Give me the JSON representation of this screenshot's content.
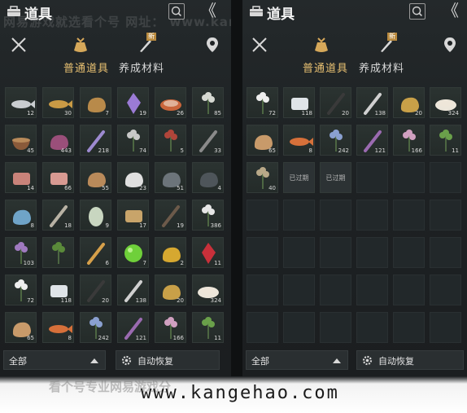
{
  "watermark_top": "网易游戏就选看个号    网址：  www.kangehao.com",
  "footer": {
    "watermark": "看个号专业网易游戏分",
    "url": "www.kangehao.com"
  },
  "colors": {
    "accent": "#e9c172",
    "panel": "#1e2224",
    "cell": "#2b3331"
  },
  "panels": [
    {
      "title": "道具",
      "tabs": [
        "普通道具",
        "养成材料"
      ],
      "active_tab": 0,
      "new_badge": "新",
      "filter_label": "全部",
      "auto_recover_label": "自动恢复",
      "items": [
        {
          "icon": "fish-icon",
          "count": "12"
        },
        {
          "icon": "golden-fish-icon",
          "count": "30"
        },
        {
          "icon": "ore-pile-icon",
          "count": "7"
        },
        {
          "icon": "purple-crystal-icon",
          "count": "19"
        },
        {
          "icon": "meat-plate-icon",
          "count": "26"
        },
        {
          "icon": "white-herb-icon",
          "count": "85"
        },
        {
          "icon": "spice-bowl-icon",
          "count": "45"
        },
        {
          "icon": "mushroom-icon",
          "count": "443"
        },
        {
          "icon": "lavender-icon",
          "count": "218"
        },
        {
          "icon": "flower-stalk-icon",
          "count": "74"
        },
        {
          "icon": "red-herb-icon",
          "count": "5"
        },
        {
          "icon": "feather-icon",
          "count": "33"
        },
        {
          "icon": "raw-meat-icon",
          "count": "14"
        },
        {
          "icon": "sliced-meat-icon",
          "count": "66"
        },
        {
          "icon": "wood-log-icon",
          "count": "55"
        },
        {
          "icon": "white-stone-icon",
          "count": "23"
        },
        {
          "icon": "iron-ore-icon",
          "count": "51"
        },
        {
          "icon": "dark-ore-icon",
          "count": "4"
        },
        {
          "icon": "blue-ore-icon",
          "count": "8"
        },
        {
          "icon": "bone-icon",
          "count": "18"
        },
        {
          "icon": "egg-icon",
          "count": "9"
        },
        {
          "icon": "bread-stack-icon",
          "count": "17"
        },
        {
          "icon": "dry-branch-icon",
          "count": "19"
        },
        {
          "icon": "white-flower-icon",
          "count": "386"
        },
        {
          "icon": "violet-flower-icon",
          "count": "103"
        },
        {
          "icon": "green-herb-icon",
          "count": ""
        },
        {
          "icon": "torch-icon",
          "count": "6"
        },
        {
          "icon": "green-orb-icon",
          "count": "7"
        },
        {
          "icon": "gold-nugget-icon",
          "count": "2"
        },
        {
          "icon": "red-gem-icon",
          "count": "11"
        },
        {
          "icon": "white-lotus-icon",
          "count": "72"
        },
        {
          "icon": "jade-jar-icon",
          "count": "118"
        },
        {
          "icon": "black-feather-icon",
          "count": "20"
        },
        {
          "icon": "ink-brush-icon",
          "count": "138"
        },
        {
          "icon": "gold-ore-icon",
          "count": "20"
        },
        {
          "icon": "rice-bowl-icon",
          "count": "324"
        },
        {
          "icon": "nut-pile-icon",
          "count": "65"
        },
        {
          "icon": "orange-fish-icon",
          "count": "8"
        },
        {
          "icon": "blue-flower-icon",
          "count": "242"
        },
        {
          "icon": "purple-spike-icon",
          "count": "121"
        },
        {
          "icon": "pink-blossom-icon",
          "count": "166"
        },
        {
          "icon": "green-sprout-icon",
          "count": "11"
        }
      ]
    },
    {
      "title": "道具",
      "tabs": [
        "普通道具",
        "养成材料"
      ],
      "active_tab": 0,
      "new_badge": "新",
      "filter_label": "全部",
      "auto_recover_label": "自动恢复",
      "expired_label": "已过期",
      "items": [
        {
          "icon": "white-lotus-icon",
          "count": "72"
        },
        {
          "icon": "jade-jar-icon",
          "count": "118"
        },
        {
          "icon": "black-feather-icon",
          "count": "20"
        },
        {
          "icon": "ink-brush-icon",
          "count": "138"
        },
        {
          "icon": "gold-ore-icon",
          "count": "20"
        },
        {
          "icon": "rice-bowl-icon",
          "count": "324"
        },
        {
          "icon": "nut-pile-icon",
          "count": "65"
        },
        {
          "icon": "orange-fish-icon",
          "count": "8"
        },
        {
          "icon": "blue-flower-icon",
          "count": "242"
        },
        {
          "icon": "purple-spike-icon",
          "count": "121"
        },
        {
          "icon": "pink-blossom-icon",
          "count": "166"
        },
        {
          "icon": "green-sprout-icon",
          "count": "11"
        },
        {
          "icon": "ginseng-icon",
          "count": "40"
        },
        {
          "icon": "expired-item-icon",
          "count": "",
          "expired": true
        },
        {
          "icon": "expired-item-icon",
          "count": "",
          "expired": true
        }
      ]
    }
  ]
}
